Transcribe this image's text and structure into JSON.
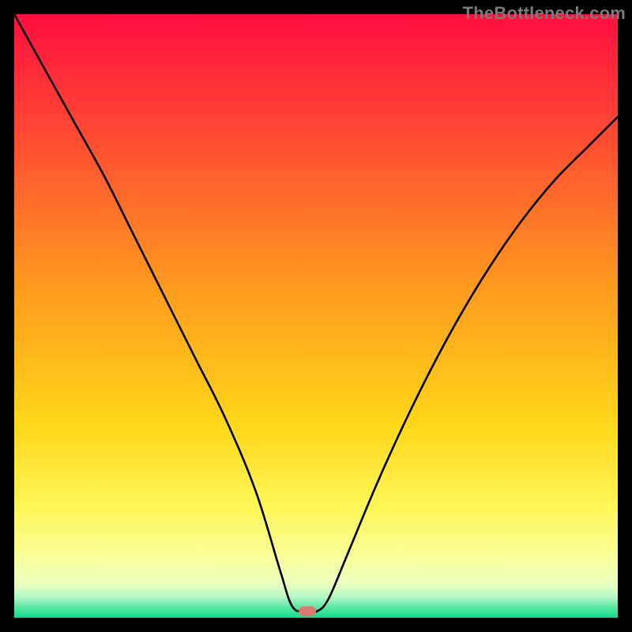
{
  "watermark": "TheBottleneck.com",
  "marker_color": "#d97a6e",
  "chart_data": {
    "type": "line",
    "title": "",
    "xlabel": "",
    "ylabel": "",
    "xlim": [
      0,
      100
    ],
    "ylim": [
      0,
      100
    ],
    "series": [
      {
        "name": "bottleneck-curve",
        "x": [
          0,
          5,
          10,
          15,
          20,
          25,
          30,
          35,
          40,
          44,
          46,
          48,
          50,
          52,
          55,
          60,
          65,
          70,
          75,
          80,
          85,
          90,
          95,
          100
        ],
        "values": [
          100,
          91,
          82,
          73,
          63,
          53,
          43,
          33,
          21,
          8,
          2,
          1,
          1,
          3,
          10,
          22,
          33,
          43,
          52,
          60,
          67,
          73,
          78,
          83
        ]
      }
    ],
    "marker": {
      "x": 48.5,
      "y": 1
    },
    "background_gradient": {
      "stops": [
        {
          "pos": 0.0,
          "color": "#ff0f3f"
        },
        {
          "pos": 0.2,
          "color": "#ff4a34"
        },
        {
          "pos": 0.45,
          "color": "#ff9a1f"
        },
        {
          "pos": 0.68,
          "color": "#ffd71a"
        },
        {
          "pos": 0.82,
          "color": "#fff75a"
        },
        {
          "pos": 0.9,
          "color": "#f9ff9a"
        },
        {
          "pos": 0.945,
          "color": "#e8ffc0"
        },
        {
          "pos": 0.965,
          "color": "#b8f7c6"
        },
        {
          "pos": 0.982,
          "color": "#5fe6a4"
        },
        {
          "pos": 1.0,
          "color": "#11da8a"
        }
      ]
    }
  }
}
